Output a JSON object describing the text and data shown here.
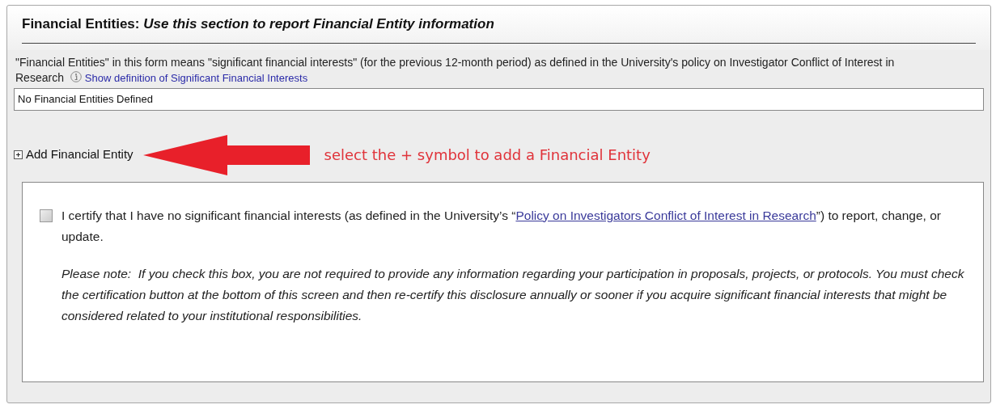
{
  "section": {
    "title": "Financial Entities:",
    "subtitle": "Use this section to report Financial Entity information"
  },
  "description": {
    "text": "\"Financial Entities\" in this form means \"significant financial interests\" (for the previous 12-month period) as defined in the University's policy on Investigator Conflict of Interest in Research",
    "link": "Show definition of Significant Financial Interests"
  },
  "entities_field": {
    "value": "No Financial Entities Defined"
  },
  "add_entity": {
    "label": "Add Financial Entity",
    "expanded": false
  },
  "annotation": {
    "text": "select the + symbol to add a Financial Entity"
  },
  "certification": {
    "checked": false,
    "before": "I certify that I have no significant financial interests (as defined in the University’s “",
    "link": "Policy on Investigators Conflict of Interest in Research",
    "after": "”) to report, change, or update.",
    "note": "Please note:  If you check this box, you are not required to provide any information regarding your participation in proposals, projects, or protocols. You must check the certification button at the bottom of this screen and then re-certify this disclosure annually or sooner if you acquire significant financial interests that might be considered related to your institutional responsibilities."
  }
}
